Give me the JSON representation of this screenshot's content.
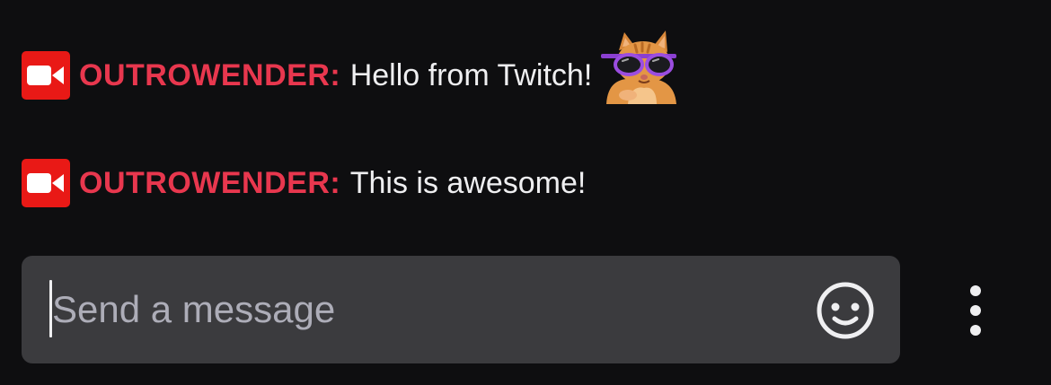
{
  "colors": {
    "background": "#0e0e10",
    "badge": "#e91916",
    "username": "#e8374e",
    "message_text": "#efeff1",
    "input_background": "#3b3b3e",
    "placeholder": "#adadb8"
  },
  "messages": [
    {
      "badge_icon": "video-camera-icon",
      "username": "OUTROWENDER",
      "separator": ":",
      "text": "Hello from Twitch!",
      "emote": "cat-sunglasses-emote"
    },
    {
      "badge_icon": "video-camera-icon",
      "username": "OUTROWENDER",
      "separator": ":",
      "text": "This is awesome!"
    }
  ],
  "composer": {
    "placeholder": "Send a message",
    "value": "",
    "emoji_icon": "smiley-face-icon",
    "more_icon": "vertical-ellipsis-icon"
  }
}
